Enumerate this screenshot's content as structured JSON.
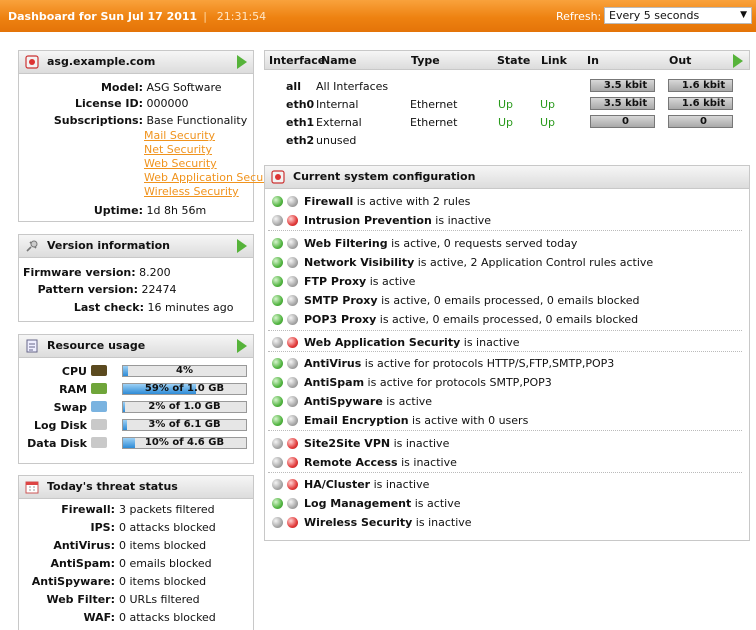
{
  "topbar": {
    "title": "Dashboard for Sun Jul 17 2011",
    "time": "21:31:54",
    "refresh_label": "Refresh:",
    "refresh_value": "Every 5 seconds"
  },
  "host": {
    "name": "asg.example.com",
    "model_label": "Model:",
    "model": "ASG Software",
    "license_label": "License ID:",
    "license": "000000",
    "subs_label": "Subscriptions:",
    "subs_base": "Base Functionality",
    "subs_links": [
      "Mail Security",
      "Net Security",
      "Web Security",
      "Web Application Security",
      "Wireless Security"
    ],
    "uptime_label": "Uptime:",
    "uptime": "1d 8h 56m"
  },
  "version": {
    "title": "Version information",
    "fw_label": "Firmware version:",
    "fw": "8.200",
    "pattern_label": "Pattern version:",
    "pattern": "22474",
    "check_label": "Last check:",
    "check": "16 minutes ago"
  },
  "resources": {
    "title": "Resource usage",
    "items": [
      {
        "label": "CPU",
        "text": "4%",
        "fraction": 0.04
      },
      {
        "label": "RAM",
        "text": "59% of 1.0 GB",
        "fraction": 0.59
      },
      {
        "label": "Swap",
        "text": "2% of 1.0 GB",
        "fraction": 0.02
      },
      {
        "label": "Log Disk",
        "text": "3% of 6.1 GB",
        "fraction": 0.03
      },
      {
        "label": "Data Disk",
        "text": "10% of 4.6 GB",
        "fraction": 0.1
      }
    ]
  },
  "threat": {
    "title": "Today's threat status",
    "items": [
      {
        "k": "Firewall:",
        "v": "3 packets filtered"
      },
      {
        "k": "IPS:",
        "v": "0 attacks blocked"
      },
      {
        "k": "AntiVirus:",
        "v": "0 items blocked"
      },
      {
        "k": "AntiSpam:",
        "v": "0 emails blocked"
      },
      {
        "k": "AntiSpyware:",
        "v": "0 items blocked"
      },
      {
        "k": "Web Filter:",
        "v": "0 URLs filtered"
      },
      {
        "k": "WAF:",
        "v": "0 attacks blocked"
      }
    ]
  },
  "interfaces": {
    "headers": {
      "iface": "Interface",
      "name": "Name",
      "type": "Type",
      "state": "State",
      "link": "Link",
      "in": "In",
      "out": "Out"
    },
    "rows": [
      {
        "iface": "all",
        "name": "All Interfaces",
        "type": "",
        "state": "",
        "link": "",
        "in": "3.5 kbit",
        "out": "1.6 kbit"
      },
      {
        "iface": "eth0",
        "name": "Internal",
        "type": "Ethernet",
        "state": "Up",
        "link": "Up",
        "in": "3.5 kbit",
        "out": "1.6 kbit"
      },
      {
        "iface": "eth1",
        "name": "External",
        "type": "Ethernet",
        "state": "Up",
        "link": "Up",
        "in": "0",
        "out": "0"
      },
      {
        "iface": "eth2",
        "name": "unused",
        "type": "",
        "state": "",
        "link": "",
        "in": "",
        "out": ""
      }
    ]
  },
  "config": {
    "title": "Current system configuration",
    "items": [
      {
        "name": "Firewall",
        "rest": " is active with 2 rules",
        "dot2": "gr"
      },
      {
        "name": "Intrusion Prevention",
        "rest": " is inactive",
        "dot2": "r"
      },
      {
        "name": "Web Filtering",
        "rest": " is active, 0 requests served today",
        "dot2": "gr"
      },
      {
        "name": "Network Visibility",
        "rest": " is active, 2 Application Control rules active",
        "dot2": "gr"
      },
      {
        "name": "FTP Proxy",
        "rest": " is active",
        "dot2": "gr"
      },
      {
        "name": "SMTP Proxy",
        "rest": " is active, 0 emails processed, 0 emails blocked",
        "dot2": "gr"
      },
      {
        "name": "POP3 Proxy",
        "rest": " is active, 0 emails processed, 0 emails blocked",
        "dot2": "gr"
      },
      {
        "name": "Web Application Security",
        "rest": " is inactive",
        "dot2": "r"
      },
      {
        "name": "AntiVirus",
        "rest": " is active for protocols HTTP/S,FTP,SMTP,POP3",
        "dot2": "gr"
      },
      {
        "name": "AntiSpam",
        "rest": " is active for protocols SMTP,POP3",
        "dot2": "gr"
      },
      {
        "name": "AntiSpyware",
        "rest": " is active",
        "dot2": "gr"
      },
      {
        "name": "Email Encryption",
        "rest": " is active with 0 users",
        "dot2": "gr"
      },
      {
        "name": "Site2Site VPN",
        "rest": " is inactive",
        "dot2": "r"
      },
      {
        "name": "Remote Access",
        "rest": " is inactive",
        "dot2": "r"
      },
      {
        "name": "HA/Cluster",
        "rest": " is inactive",
        "dot2": "r"
      },
      {
        "name": "Log Management",
        "rest": " is active",
        "dot2": "gr"
      },
      {
        "name": "Wireless Security",
        "rest": " is inactive",
        "dot2": "r"
      }
    ]
  },
  "colors": {
    "accent": "#ee8211",
    "link": "#f0931d",
    "status_up": "#2a9a1c"
  }
}
